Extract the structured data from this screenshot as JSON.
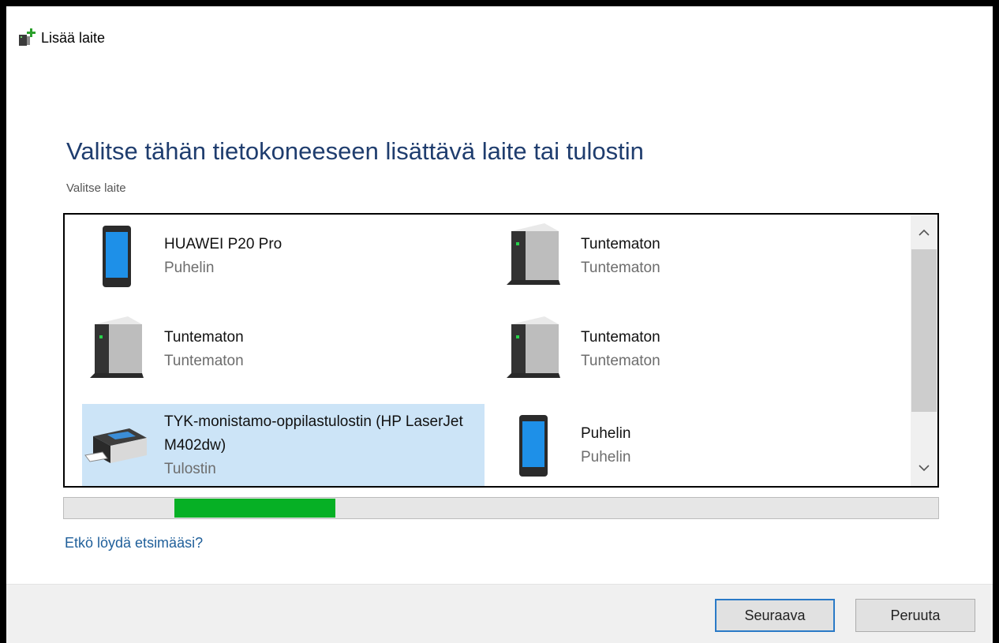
{
  "window": {
    "title": "Lisää laite"
  },
  "heading": "Valitse tähän tietokoneeseen lisättävä laite tai tulostin",
  "subheading": "Valitse laite",
  "devices": [
    {
      "name": "HUAWEI P20 Pro",
      "type": "Puhelin",
      "icon": "phone-icon",
      "selected": false
    },
    {
      "name": "Tuntematon",
      "type": "Tuntematon",
      "icon": "computer-tower-icon",
      "selected": false
    },
    {
      "name": "Tuntematon",
      "type": "Tuntematon",
      "icon": "computer-tower-icon",
      "selected": false
    },
    {
      "name": "Tuntematon",
      "type": "Tuntematon",
      "icon": "computer-tower-icon",
      "selected": false
    },
    {
      "name": "TYK-monistamo-oppilastulostin (HP LaserJet M402dw)",
      "type": "Tulostin",
      "icon": "printer-icon",
      "selected": true
    },
    {
      "name": "Puhelin",
      "type": "Puhelin",
      "icon": "phone-icon",
      "selected": false
    }
  ],
  "link": "Etkö löydä etsimääsi?",
  "buttons": {
    "next": "Seuraava",
    "cancel": "Peruuta"
  },
  "colors": {
    "heading": "#1f3d6e",
    "selection": "#cce4f7",
    "progress": "#06b025",
    "link": "#1f5f9a",
    "primary_border": "#2a7ac7"
  }
}
